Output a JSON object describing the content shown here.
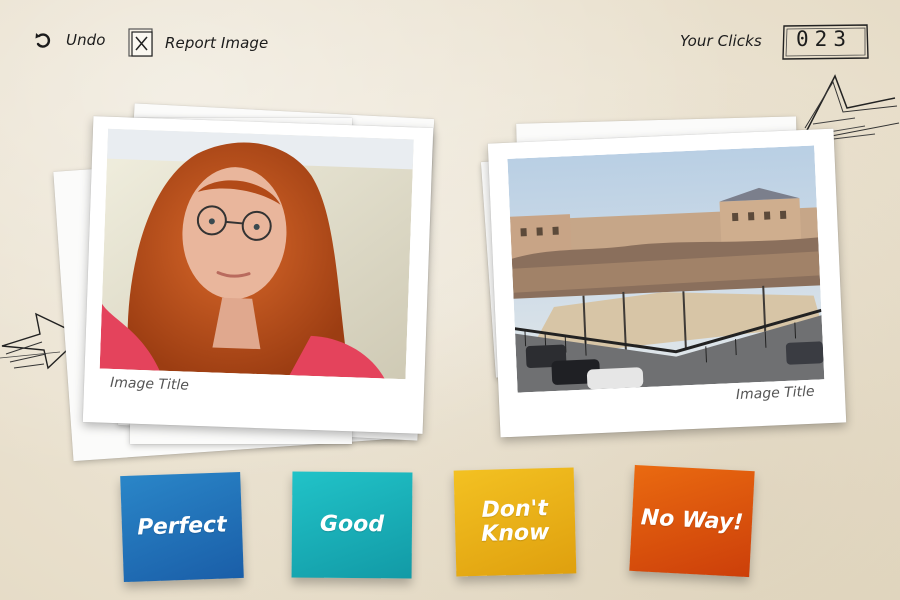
{
  "toolbar": {
    "undo_label": "Undo",
    "report_label": "Report Image",
    "clicks_label": "Your Clicks",
    "clicks_value": "023"
  },
  "photos": {
    "left": {
      "caption": "Image Title"
    },
    "right": {
      "caption": "Image Title"
    }
  },
  "ratings": {
    "perfect": "Perfect",
    "good": "Good",
    "dont_know": "Don't Know",
    "no_way": "No Way!"
  },
  "colors": {
    "perfect": "#1f6fb8",
    "good": "#19b3bb",
    "dont_know": "#ecb418",
    "no_way": "#dd520c",
    "background": "#efe8d9"
  },
  "icons": [
    "undo-icon",
    "report-box-icon"
  ]
}
